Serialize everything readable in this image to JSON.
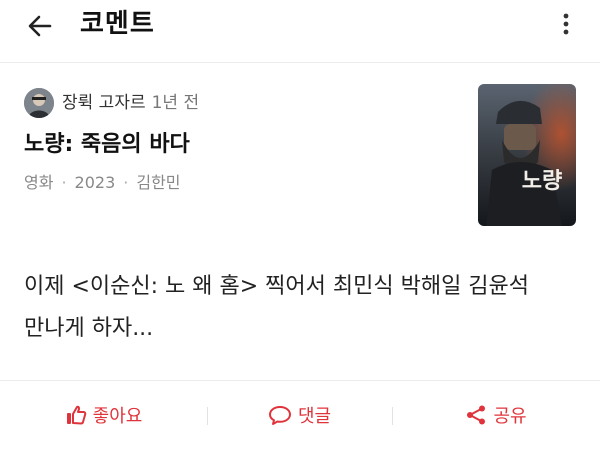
{
  "header": {
    "title": "코멘트",
    "back_icon": "back-arrow-icon",
    "more_icon": "more-vertical-icon"
  },
  "comment": {
    "author": "장뤽 고자르",
    "time_ago": "1년 전",
    "movie_title": "노량: 죽음의 바다",
    "meta": {
      "type": "영화",
      "year": "2023",
      "director": "김한민"
    },
    "body_line1": "이제 <이순신: 노 왜 홈> 찍어서 최민식 박해일 김윤석",
    "body_line2": "만나게 하자..."
  },
  "poster": {
    "title_text": "노량"
  },
  "actions": {
    "like_label": "좋아요",
    "reply_label": "댓글",
    "share_label": "공유",
    "accent_color": "#e0343c"
  }
}
